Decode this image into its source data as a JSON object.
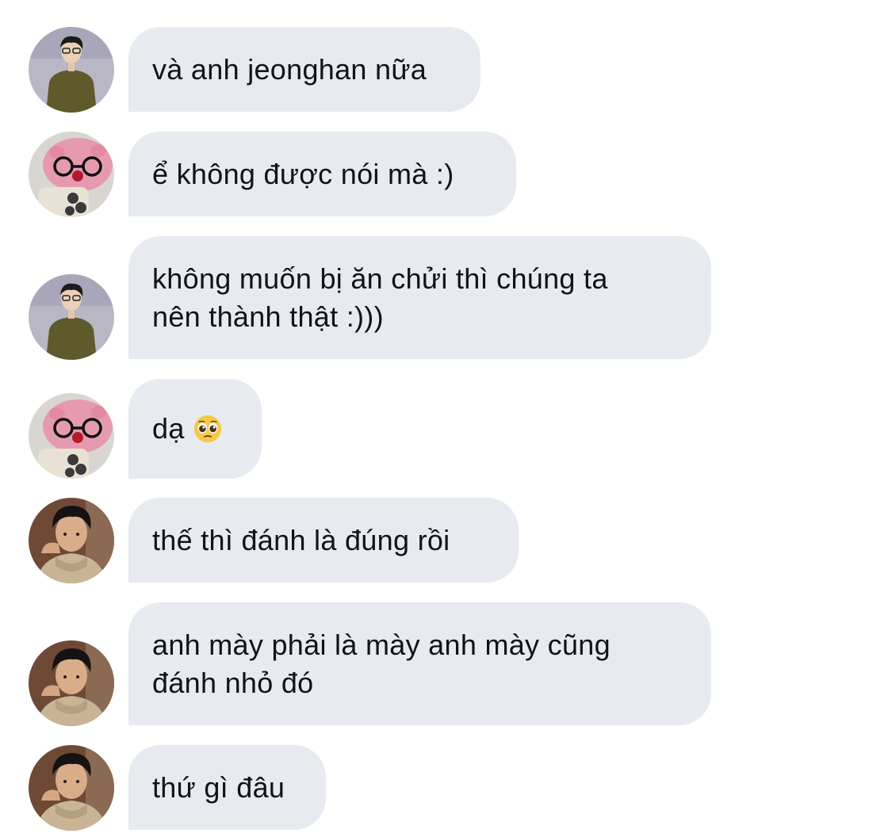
{
  "messages": [
    {
      "avatar": "avatar-man-olive-shirt",
      "text": "và anh jeonghan nữa"
    },
    {
      "avatar": "avatar-pink-plush-glasses",
      "text": "ể không được nói mà :)"
    },
    {
      "avatar": "avatar-man-olive-shirt",
      "text": "không muốn bị ăn chửi thì chúng ta\nnên thành thật :)))"
    },
    {
      "avatar": "avatar-pink-plush-glasses",
      "text": "dạ",
      "emoji": "pleading-face-emoji"
    },
    {
      "avatar": "avatar-man-hoodie",
      "text": "thế thì đánh là đúng rồi"
    },
    {
      "avatar": "avatar-man-hoodie",
      "text": "anh mày phải là mày anh mày cũng\nđánh nhỏ đó"
    },
    {
      "avatar": "avatar-man-hoodie",
      "text": "thứ gì đâu"
    }
  ],
  "colors": {
    "bubble_bg": "#e7ebf0",
    "text": "#0f1419",
    "background": "#ffffff"
  }
}
